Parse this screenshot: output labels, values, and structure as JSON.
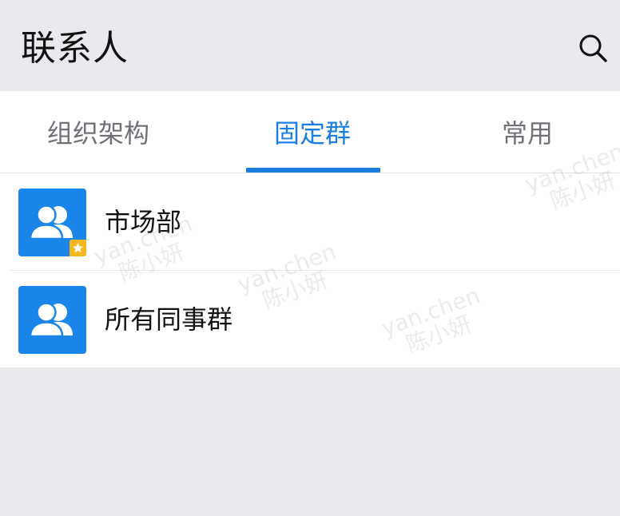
{
  "header": {
    "title": "联系人",
    "search_icon": "search-icon"
  },
  "tabs": [
    {
      "label": "组织架构",
      "active": false
    },
    {
      "label": "固定群",
      "active": true
    },
    {
      "label": "常用",
      "active": false
    }
  ],
  "groups": [
    {
      "name": "市场部",
      "icon": "group-icon",
      "starred": true
    },
    {
      "name": "所有同事群",
      "icon": "group-icon",
      "starred": false
    }
  ],
  "watermark": {
    "line1": "yan.chen",
    "line2": "陈小妍"
  },
  "colors": {
    "accent": "#1a7fe0",
    "avatar_bg": "#1a86ea",
    "star_badge": "#f6b81e",
    "page_bg": "#e8eaee"
  }
}
